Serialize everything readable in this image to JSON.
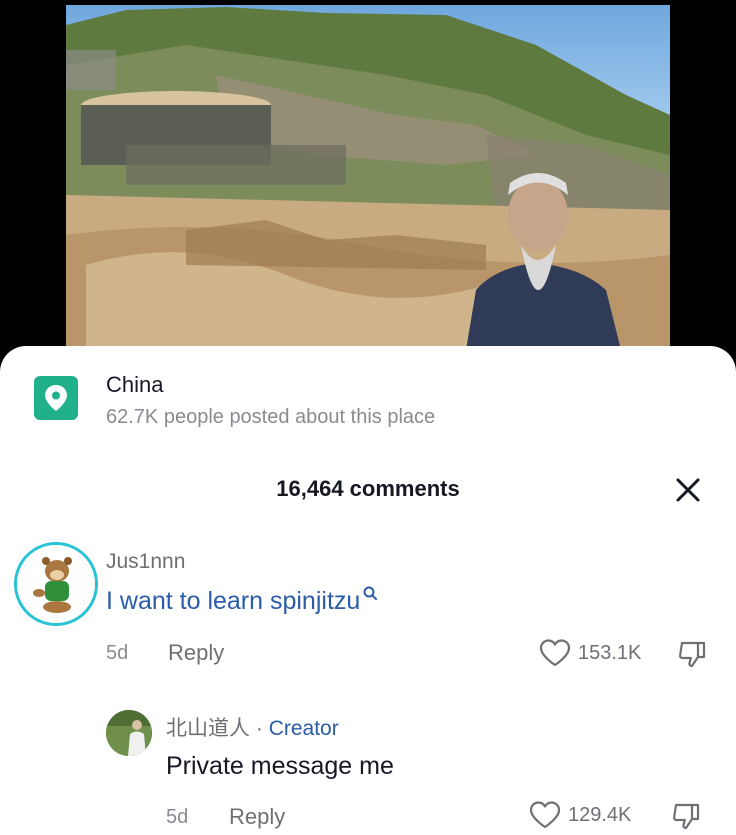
{
  "location": {
    "name": "China",
    "subtitle": "62.7K people posted about this place",
    "icon": "location-pin-icon",
    "badge_color": "#20b08a"
  },
  "comments_header": {
    "count_label": "16,464 comments",
    "close_icon": "close-icon"
  },
  "comments": [
    {
      "username": "Jus1nnn",
      "text": "I want to learn spinjitzu",
      "text_icon": "search-icon",
      "time": "5d",
      "reply_label": "Reply",
      "likes": "153.1K"
    }
  ],
  "replies": [
    {
      "username": "北山道人",
      "separator": "·",
      "badge": "Creator",
      "text": "Private message me",
      "time": "5d",
      "reply_label": "Reply",
      "likes": "129.4K"
    }
  ],
  "colors": {
    "link_blue": "#2b5ca8",
    "avatar_ring": "#26c4d6",
    "muted_text": "#8a8b91"
  }
}
